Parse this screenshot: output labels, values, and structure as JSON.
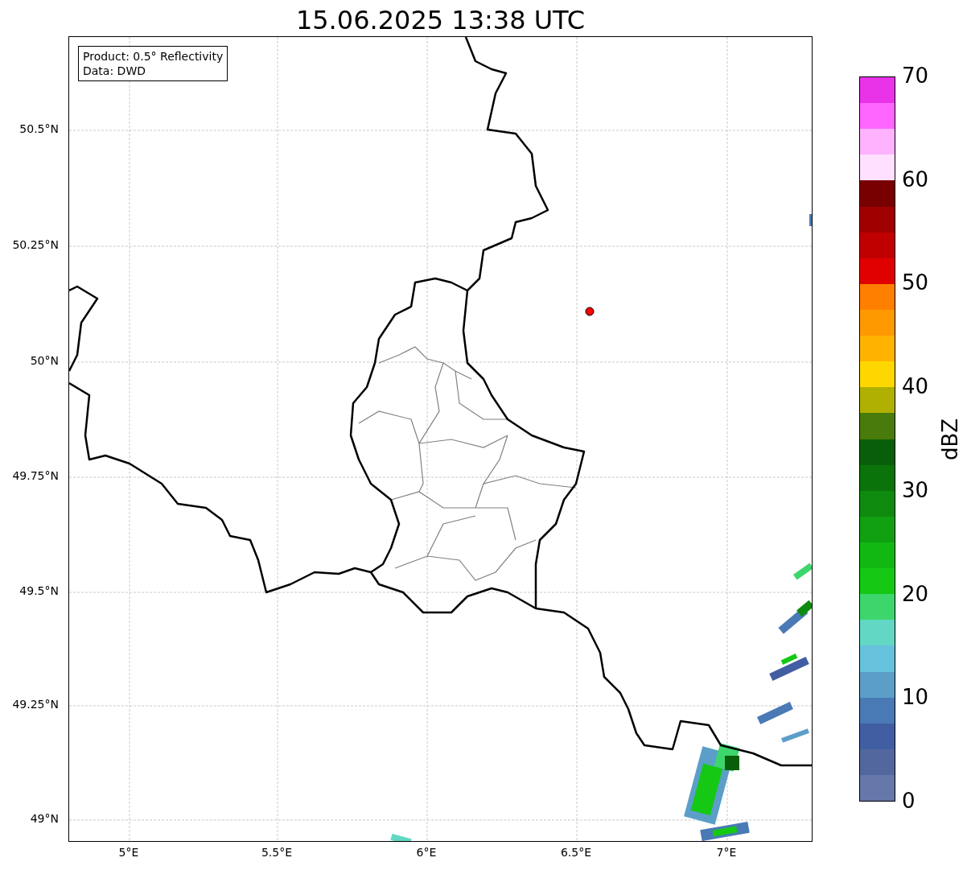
{
  "title": "15.06.2025 13:38 UTC",
  "info_box": [
    "Product: 0.5° Reflectivity",
    "Data: DWD"
  ],
  "x_ticks": [
    "5°E",
    "5.5°E",
    "6°E",
    "6.5°E",
    "7°E"
  ],
  "y_ticks": [
    "50.5°N",
    "50.25°N",
    "50°N",
    "49.75°N",
    "49.5°N",
    "49.25°N",
    "49°N"
  ],
  "colorbar": {
    "label": "dBZ",
    "ticks": [
      "70",
      "60",
      "50",
      "40",
      "30",
      "20",
      "10",
      "0"
    ],
    "levels": [
      {
        "color": "#e833e8"
      },
      {
        "color": "#ff66ff"
      },
      {
        "color": "#ffb3ff"
      },
      {
        "color": "#ffe0ff"
      },
      {
        "color": "#780000"
      },
      {
        "color": "#a00000"
      },
      {
        "color": "#c00000"
      },
      {
        "color": "#e00000"
      },
      {
        "color": "#ff7f00"
      },
      {
        "color": "#ff9900"
      },
      {
        "color": "#ffb300"
      },
      {
        "color": "#ffd700"
      },
      {
        "color": "#b0b000"
      },
      {
        "color": "#487b0b"
      },
      {
        "color": "#095f09"
      },
      {
        "color": "#0a730a"
      },
      {
        "color": "#0e8b0e"
      },
      {
        "color": "#10a010"
      },
      {
        "color": "#12b812"
      },
      {
        "color": "#14c814"
      },
      {
        "color": "#3dd66d"
      },
      {
        "color": "#62d8c4"
      },
      {
        "color": "#66c2dd"
      },
      {
        "color": "#5b9fc8"
      },
      {
        "color": "#4a7ab5"
      },
      {
        "color": "#425ea3"
      },
      {
        "color": "#52679e"
      },
      {
        "color": "#6677aa"
      }
    ]
  }
}
